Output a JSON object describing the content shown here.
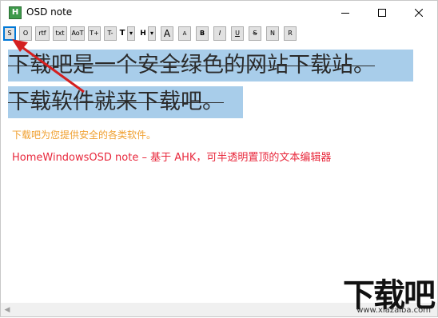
{
  "window": {
    "title": "OSD note",
    "app_icon_letter": "H"
  },
  "toolbar": {
    "buttons": [
      {
        "id": "s",
        "label": "S"
      },
      {
        "id": "o",
        "label": "O"
      },
      {
        "id": "rtf",
        "label": "rtf"
      },
      {
        "id": "txt",
        "label": "txt"
      },
      {
        "id": "aot",
        "label": "AoT"
      },
      {
        "id": "tplus",
        "label": "T+"
      },
      {
        "id": "tminus",
        "label": "T-"
      },
      {
        "id": "tdrop",
        "label": "T"
      },
      {
        "id": "hdrop",
        "label": "H"
      },
      {
        "id": "abig",
        "label": "A"
      },
      {
        "id": "asmall",
        "label": "A"
      },
      {
        "id": "b",
        "label": "B"
      },
      {
        "id": "i",
        "label": "I"
      },
      {
        "id": "u",
        "label": "U"
      },
      {
        "id": "strike",
        "label": "S"
      },
      {
        "id": "n",
        "label": "N"
      },
      {
        "id": "r",
        "label": "R"
      }
    ],
    "dropdown_arrow": "▾"
  },
  "content": {
    "line1": "下载吧是一个安全绿色的网站下载站。",
    "line2": "下载软件就来下载吧。",
    "line3": "下载吧为您提供安全的各类软件。",
    "line4": "HomeWindowsOSD note – 基于 AHK，可半透明置顶的文本编辑器"
  },
  "colors": {
    "selection": "#a8cdea",
    "line3": "#f0a030",
    "line4": "#e8283c",
    "arrow": "#d42020"
  },
  "watermark": {
    "text": "下载吧",
    "url": "www.xiazaiba.com"
  }
}
